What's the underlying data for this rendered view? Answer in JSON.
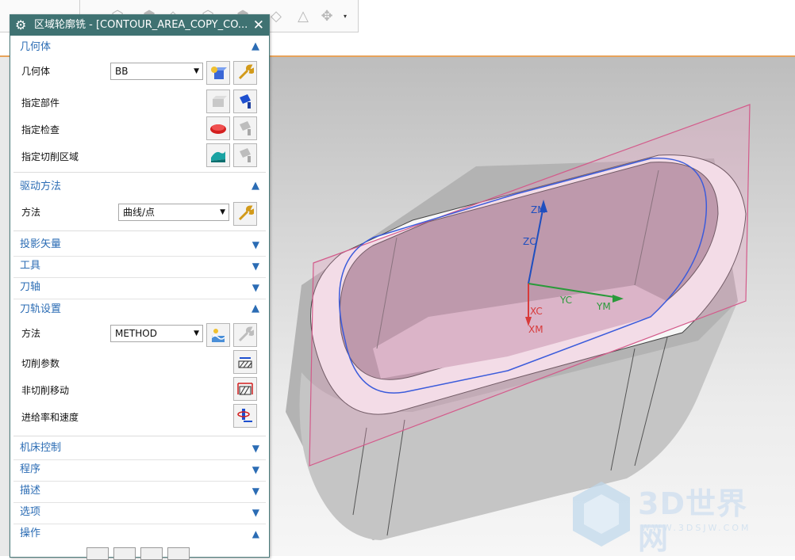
{
  "dialog": {
    "title": "区域轮廓铣 - [CONTOUR_AREA_COPY_CO...",
    "close_glyph": "✕",
    "sections": {
      "geometry": {
        "title": "几何体",
        "geometry_label": "几何体",
        "geometry_value": "BB",
        "specify_part": "指定部件",
        "specify_check": "指定检查",
        "specify_cut_area": "指定切削区域"
      },
      "drive": {
        "title": "驱动方法",
        "method_label": "方法",
        "method_value": "曲线/点"
      },
      "projection": {
        "title": "投影矢量"
      },
      "tool": {
        "title": "工具"
      },
      "axis": {
        "title": "刀轴"
      },
      "path": {
        "title": "刀轨设置",
        "method_label": "方法",
        "method_value": "METHOD",
        "cut_params": "切削参数",
        "non_cut_moves": "非切削移动",
        "feeds_speeds": "进给率和速度"
      },
      "machine": {
        "title": "机床控制"
      },
      "program": {
        "title": "程序"
      },
      "description": {
        "title": "描述"
      },
      "options": {
        "title": "选项"
      },
      "actions": {
        "title": "操作"
      }
    }
  },
  "viewport": {
    "axes": {
      "zm": "ZM",
      "zc": "ZC",
      "yc": "YC",
      "ym": "YM",
      "xc": "XC",
      "xm": "XM"
    }
  },
  "watermark": {
    "text": "3D世界网",
    "sub": "WWW.3DSJW.COM"
  },
  "colors": {
    "accent": "#2b6cb4",
    "title_bar": "#3f7272",
    "plane": "#d35a8a",
    "axis_z": "#1f4fbf",
    "axis_y": "#2a9a3a",
    "axis_x": "#d83a3a"
  },
  "icons": [
    "gear-icon",
    "close-icon",
    "select-geometry-icon",
    "wrench-icon",
    "part-icon",
    "flashlight-icon",
    "check-geometry-icon",
    "cut-area-icon",
    "cut-params-icon",
    "non-cut-moves-icon",
    "feeds-speeds-icon",
    "chevron-up-icon",
    "chevron-down-icon"
  ]
}
